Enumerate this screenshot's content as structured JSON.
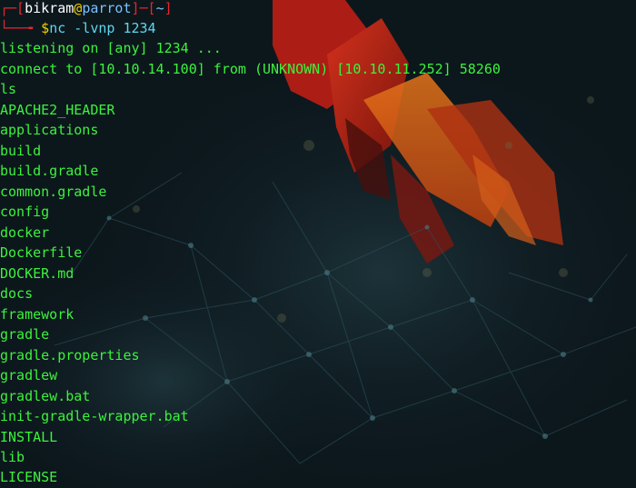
{
  "prompt": {
    "bracket_open": "┌─[",
    "user": "bikram",
    "at": "@",
    "host": "parrot",
    "separator": "]─[",
    "dir": "~",
    "bracket_close": "]",
    "second_line_prefix": "└──╼ ",
    "dollar": "$",
    "command": "nc -lvnp 1234"
  },
  "output": [
    "listening on [any] 1234 ...",
    "connect to [10.10.14.100] from (UNKNOWN) [10.10.11.252] 58260",
    "ls",
    "APACHE2_HEADER",
    "applications",
    "build",
    "build.gradle",
    "common.gradle",
    "config",
    "docker",
    "Dockerfile",
    "DOCKER.md",
    "docs",
    "framework",
    "gradle",
    "gradle.properties",
    "gradlew",
    "gradlew.bat",
    "init-gradle-wrapper.bat",
    "INSTALL",
    "lib",
    "LICENSE"
  ],
  "colors": {
    "background": "#0d1a1f",
    "output_text": "#3cf23c",
    "prompt_frame": "#e5262f",
    "prompt_user": "#ffffff",
    "prompt_host": "#79c3ff",
    "prompt_dollar": "#f2d000",
    "command_text": "#5dd8f0"
  }
}
